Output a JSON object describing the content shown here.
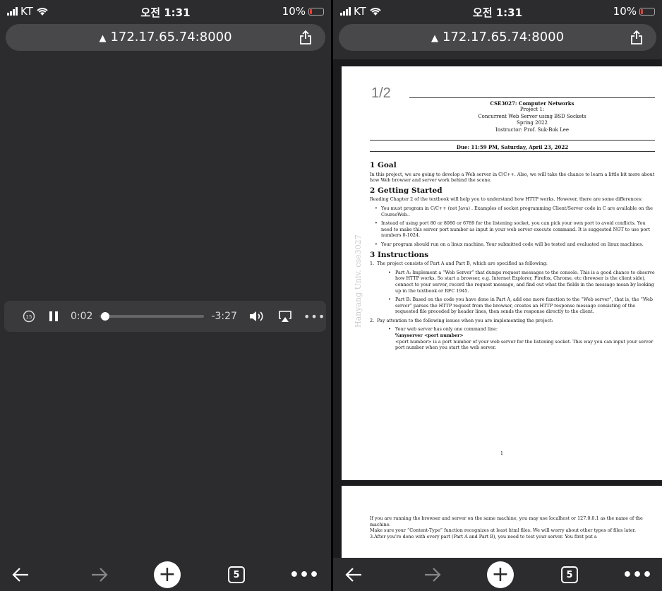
{
  "status": {
    "carrier": "KT",
    "time": "오전 1:31",
    "battery": "10%"
  },
  "browser": {
    "url": "172.17.65.74:8000",
    "tab_count": "5"
  },
  "player": {
    "elapsed": "0:02",
    "remaining": "-3:27",
    "skip_label": "15",
    "progress_fraction": 0.01
  },
  "document": {
    "page_indicator": "1/2",
    "course": "CSE3027: Computer Networks",
    "project": "Project 1:",
    "subtitle": "Concurrent Web Server using BSD Sockets",
    "term": "Spring 2022",
    "instructor": "Instructor: Prof. Suk-Bok Lee",
    "due": "Due: 11:59 PM, Saturday, April 23, 2022",
    "watermark": "Hanyang Univ. cse3027",
    "s1_title": "1   Goal",
    "s1_text": "In this project, we are going to develop a Web server in C/C++. Also, we will take the chance to learn a little bit more about how Web browser and server work behind the scene.",
    "s2_title": "2   Getting Started",
    "s2_text": "Reading Chapter 2 of the textbook will help you to understand how HTTP works. However, there are some differences:",
    "s2_b1": "You must program in C/C++ (not Java) . Examples of socket programming Client/Server code in C are available on the CourseWeb..",
    "s2_b2": "Instead of using port 80 or 8080 or 6789 for the listening socket, you can pick your own port to avoid conflicts. You need to make this server port number as input in your web server execute command. It is suggested NOT to use port numbers 0-1024.",
    "s2_b3": "Your program should run on a linux machine. Your submitted code will be tested and evaluated on linux machines.",
    "s3_title": "3   Instructions",
    "s3_item1_num": "1.",
    "s3_item1": "The project consists of Part A and Part B, which are specified as following:",
    "s3_partA": "Part A: Implement a “Web Server” that dumps request messages to the console. This is a good chance to observe how HTTP works. So start a browser, e.g. Internet Explorer, Firefox, Chrome, etc (browser is the client side), connect to your server, record the request message, and find out what the fields in the message mean by looking up in the textbook or RFC 1945.",
    "s3_partB": "Part B: Based on the code you have done in Part A, add one more function to the “Web server”, that is, the “Web server” parses the HTTP request from the browser, creates an HTTP response message consisting of the requested file preceded by header lines, then sends the response directly to the client.",
    "s3_item2_num": "2.",
    "s3_item2": "Pay attention to the following issues when you are implementing the project:",
    "s3_cmd_intro": "Your web server has only one command line:",
    "s3_cmd": "%myserver <port number>",
    "s3_cmd_desc": "<port number> is a port number of your web server for the listening socket. This way you can input your server port number when you start the web server.",
    "page_number": "1",
    "p2_b1": "If you are running the browser and server on the same machine, you may use localhost or 127.0.0.1 as the name of the machine.",
    "p2_b2": "Make sure your “Content-Type” function recognizes at least html files. We will worry about other types of files later.",
    "p2_item3_num": "3.",
    "p2_item3": "After you're done with every part (Part A and Part B), you need to test your server. You first put a"
  },
  "colors": {
    "chrome": "#2c2c2e",
    "urlbar": "#48484a",
    "player": "#3a3a3c",
    "battery_low": "#ff3b30"
  },
  "icons": [
    "signal-icon",
    "wifi-icon",
    "battery-icon",
    "warning-icon",
    "share-icon",
    "skip-back-15-icon",
    "pause-icon",
    "volume-icon",
    "airplay-icon",
    "more-icon",
    "back-arrow-icon",
    "forward-arrow-icon",
    "new-tab-icon",
    "tabs-icon"
  ]
}
